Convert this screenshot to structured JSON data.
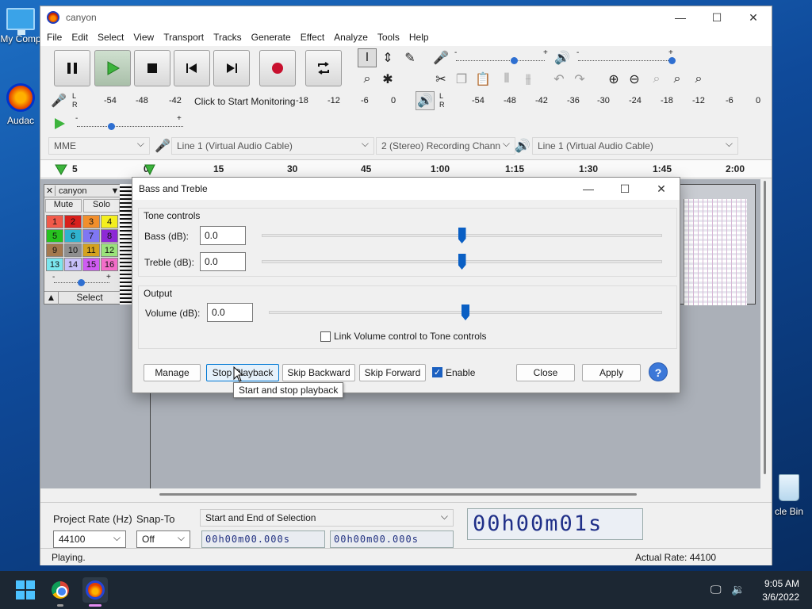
{
  "desktop": {
    "my_computer": "My Comp",
    "audacity": "Audac",
    "recycle_bin": "cle Bin"
  },
  "window": {
    "title": "canyon",
    "minimize": "—",
    "maximize": "☐",
    "close": "✕"
  },
  "menu": [
    "File",
    "Edit",
    "Select",
    "View",
    "Transport",
    "Tracks",
    "Generate",
    "Effect",
    "Analyze",
    "Tools",
    "Help"
  ],
  "meters": {
    "record_scale": [
      "-54",
      "-48",
      "-42",
      "Click to Start Monitoring",
      "-18",
      "-12",
      "-6",
      "0"
    ],
    "playback_scale": [
      "-54",
      "-48",
      "-42",
      "-36",
      "-30",
      "-24",
      "-18",
      "-12",
      "-6",
      "0"
    ],
    "L": "L",
    "R": "R"
  },
  "slider_marks": {
    "minus": "-",
    "plus": "+"
  },
  "device_toolbar": {
    "host": "MME",
    "recording_device": "Line 1 (Virtual Audio Cable)",
    "channels": "2 (Stereo) Recording Chann",
    "playback_device": "Line 1 (Virtual Audio Cable)"
  },
  "timeline": [
    "5",
    "0",
    "15",
    "30",
    "45",
    "1:00",
    "1:15",
    "1:30",
    "1:45",
    "2:00"
  ],
  "track": {
    "name": "canyon",
    "close": "✕",
    "menu_arrow": "▼",
    "mute": "Mute",
    "solo": "Solo",
    "select": "Select",
    "collapse": "▲",
    "channels": [
      {
        "n": "1",
        "color": "#f05a4a"
      },
      {
        "n": "2",
        "color": "#d8201c"
      },
      {
        "n": "3",
        "color": "#f28f2c"
      },
      {
        "n": "4",
        "color": "#f4ef1e"
      },
      {
        "n": "5",
        "color": "#27c21f"
      },
      {
        "n": "6",
        "color": "#2fb2cf"
      },
      {
        "n": "7",
        "color": "#7f77f3"
      },
      {
        "n": "8",
        "color": "#8d29d6"
      },
      {
        "n": "9",
        "color": "#a4794f"
      },
      {
        "n": "10",
        "color": "#8f8f8f"
      },
      {
        "n": "11",
        "color": "#d4a21f"
      },
      {
        "n": "12",
        "color": "#9be37b"
      },
      {
        "n": "13",
        "color": "#7be6ee"
      },
      {
        "n": "14",
        "color": "#c7c1f9"
      },
      {
        "n": "15",
        "color": "#cf5bf3"
      },
      {
        "n": "16",
        "color": "#f36ec9"
      }
    ],
    "gain_minus": "-",
    "gain_plus": "+"
  },
  "selection_bar": {
    "project_rate_label": "Project Rate (Hz)",
    "project_rate": "44100",
    "snap_to_label": "Snap-To",
    "snap_to": "Off",
    "selection_mode": "Start and End of Selection",
    "start_time": "00h00m00.000s",
    "end_time": "00h00m00.000s",
    "audio_position": "00h00m01s"
  },
  "status": {
    "left": "Playing.",
    "right": "Actual Rate: 44100"
  },
  "dialog": {
    "title": "Bass and Treble",
    "tone_controls": "Tone controls",
    "bass_label": "Bass (dB):",
    "bass_value": "0.0",
    "bass_level": 0.5,
    "treble_label": "Treble (dB):",
    "treble_value": "0.0",
    "treble_level": 0.5,
    "output": "Output",
    "volume_label": "Volume (dB):",
    "volume_value": "0.0",
    "volume_level": 0.5,
    "link_label": "Link Volume control to Tone controls",
    "link_checked": false,
    "buttons": {
      "manage": "Manage",
      "stop_playback": "Stop Playback",
      "skip_backward": "Skip Backward",
      "skip_forward": "Skip Forward",
      "enable": "Enable",
      "close": "Close",
      "apply": "Apply",
      "help": "?"
    },
    "enable_checked": true,
    "tooltip": "Start and stop playback"
  },
  "taskbar": {
    "time": "9:05 AM",
    "date": "3/6/2022"
  },
  "colors": {
    "accent": "#0a5fc4",
    "record": "#c8102e",
    "play": "#3db43d"
  }
}
